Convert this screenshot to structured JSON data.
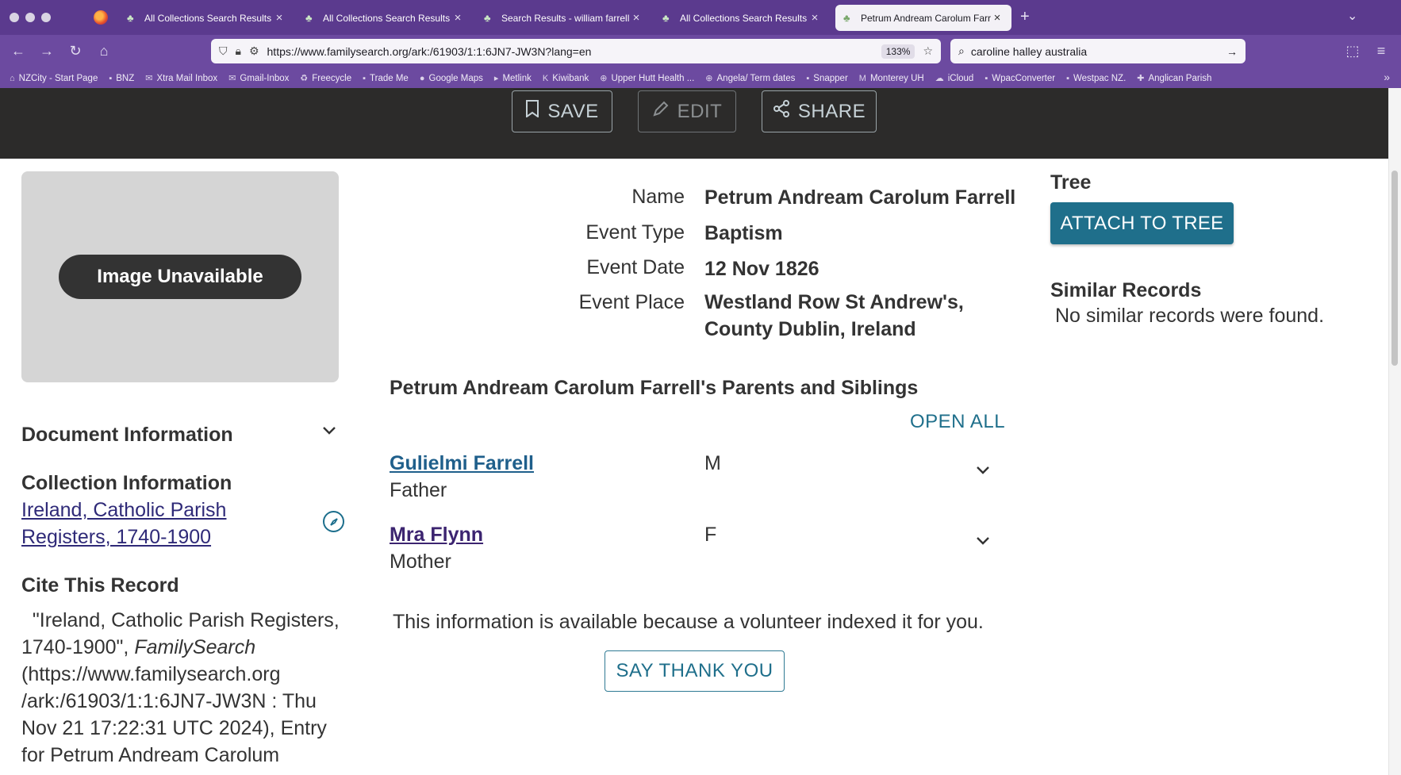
{
  "browser": {
    "tabs": [
      {
        "title": "All Collections Search Results",
        "active": false
      },
      {
        "title": "All Collections Search Results",
        "active": false
      },
      {
        "title": "Search Results - william farrell",
        "active": false
      },
      {
        "title": "All Collections Search Results",
        "active": false
      },
      {
        "title": "Petrum Andream Carolum Farrell",
        "active": true
      }
    ],
    "url": "https://www.familysearch.org/ark:/61903/1:1:6JN7-JW3N?lang=en",
    "zoom": "133%",
    "search_query": "caroline halley australia",
    "bookmarks": [
      {
        "label": "NZCity - Start Page",
        "icon": "home-icon"
      },
      {
        "label": "BNZ",
        "icon": "bank-icon"
      },
      {
        "label": "Xtra Mail Inbox",
        "icon": "mail-icon"
      },
      {
        "label": "Gmail-Inbox",
        "icon": "mail-icon"
      },
      {
        "label": "Freecycle",
        "icon": "recycle-icon"
      },
      {
        "label": "Trade Me",
        "icon": "tag-icon"
      },
      {
        "label": "Google Maps",
        "icon": "map-pin-icon"
      },
      {
        "label": "Metlink",
        "icon": "transit-icon"
      },
      {
        "label": "Kiwibank",
        "icon": "bank-icon"
      },
      {
        "label": "Upper Hutt Health ...",
        "icon": "globe-icon"
      },
      {
        "label": "Angela/ Term dates",
        "icon": "globe-icon"
      },
      {
        "label": "Snapper",
        "icon": "card-icon"
      },
      {
        "label": "Monterey UH",
        "icon": "letter-m-icon"
      },
      {
        "label": "iCloud",
        "icon": "cloud-icon"
      },
      {
        "label": "WpacConverter",
        "icon": "bank-icon"
      },
      {
        "label": "Westpac NZ.",
        "icon": "bank-icon"
      },
      {
        "label": "Anglican Parish",
        "icon": "church-icon"
      }
    ]
  },
  "header": {
    "save_label": "SAVE",
    "edit_label": "EDIT",
    "share_label": "SHARE"
  },
  "left": {
    "image_unavailable": "Image Unavailable",
    "document_info_title": "Document Information",
    "collection_info_title": "Collection Information",
    "collection_link_line1": "Ireland, Catholic Parish",
    "collection_link_line2": "Registers, 1740-1900",
    "cite_title": "Cite This Record",
    "cite_line1": "\"Ireland, Catholic Parish Registers,",
    "cite_line2_a": "1740-1900\", ",
    "cite_line2_b": "FamilySearch",
    "cite_line3": "(https://www.familysearch.org",
    "cite_line4": "/ark:/61903/1:1:6JN7-JW3N : Thu",
    "cite_line5": "Nov 21 17:22:31 UTC 2024), Entry",
    "cite_line6": "for Petrum Andream Carolum"
  },
  "facts": [
    {
      "label": "Name",
      "value": "Petrum Andream Carolum Farrell"
    },
    {
      "label": "Event Type",
      "value": "Baptism"
    },
    {
      "label": "Event Date",
      "value": "12 Nov 1826"
    },
    {
      "label": "Event Place",
      "value_line1": "Westland Row St Andrew's,",
      "value_line2": "County Dublin, Ireland"
    }
  ],
  "family": {
    "heading": "Petrum Andream Carolum Farrell's Parents and Siblings",
    "open_all": "OPEN ALL",
    "members": [
      {
        "name": "Gulielmi Farrell",
        "role": "Father",
        "sex": "M"
      },
      {
        "name": "Mra Flynn",
        "role": "Mother",
        "sex": "F"
      }
    ],
    "volunteer_text": "This information is available because a volunteer indexed it for you.",
    "thank_label": "SAY THANK YOU"
  },
  "right": {
    "tree_title": "Tree",
    "attach_label": "ATTACH TO TREE",
    "similar_title": "Similar Records",
    "similar_text": "No similar records were found."
  },
  "colors": {
    "tabbar": "#5b3a8e",
    "toolbar": "#6c4aa0",
    "header_dark": "#2c2b2a",
    "accent_teal": "#1f6f8b",
    "link_visited": "#3c2470"
  }
}
